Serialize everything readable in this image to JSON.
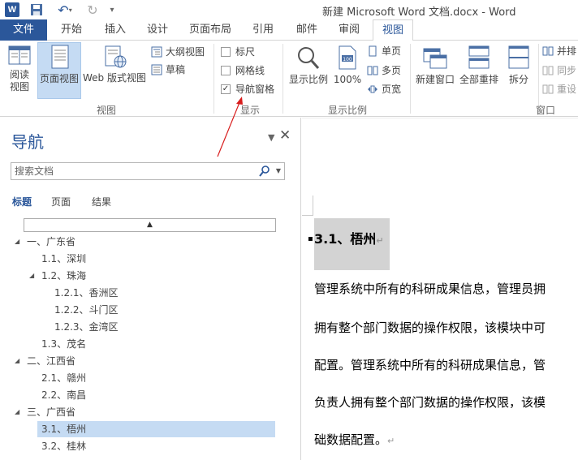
{
  "title_bar": {
    "word_logo": "W",
    "title": "新建 Microsoft Word 文档.docx - Word"
  },
  "tabs": [
    "文件",
    "开始",
    "插入",
    "设计",
    "页面布局",
    "引用",
    "邮件",
    "审阅",
    "视图"
  ],
  "active_tab": "视图",
  "ribbon": {
    "views": {
      "read_mode": "阅读\n视图",
      "print_layout": "页面视图",
      "web_layout": "Web 版式视图",
      "outline": "大纲视图",
      "draft": "草稿",
      "group_label": "视图"
    },
    "show": {
      "ruler": "标尺",
      "gridlines": "网格线",
      "nav_pane": "导航窗格",
      "ruler_checked": false,
      "gridlines_checked": false,
      "nav_pane_checked": true,
      "group_label": "显示"
    },
    "zoom": {
      "zoom": "显示比例",
      "hundred": "100%",
      "one_page": "单页",
      "multi_page": "多页",
      "page_width": "页宽",
      "group_label": "显示比例"
    },
    "window": {
      "new_window": "新建窗口",
      "arrange_all": "全部重排",
      "split": "拆分",
      "side_by_side": "并排",
      "sync": "同步",
      "reset": "重设",
      "group_label": "窗口"
    }
  },
  "nav": {
    "title": "导航",
    "search_placeholder": "搜索文档",
    "tabs": [
      "标题",
      "页面",
      "结果"
    ],
    "items": [
      {
        "text": "一、广东省",
        "collapsible": true
      },
      {
        "text": "1.1、深圳",
        "collapsible": false
      },
      {
        "text": "1.2、珠海",
        "collapsible": true
      },
      {
        "text": "1.2.1、香洲区",
        "collapsible": false
      },
      {
        "text": "1.2.2、斗门区",
        "collapsible": false
      },
      {
        "text": "1.2.3、金湾区",
        "collapsible": false
      },
      {
        "text": "1.3、茂名",
        "collapsible": false
      },
      {
        "text": "二、江西省",
        "collapsible": true
      },
      {
        "text": "2.1、赣州",
        "collapsible": false
      },
      {
        "text": "2.2、南昌",
        "collapsible": false
      },
      {
        "text": "三、广西省",
        "collapsible": true
      },
      {
        "text": "3.1、梧州",
        "collapsible": false,
        "selected": true
      },
      {
        "text": "3.2、桂林",
        "collapsible": false
      }
    ]
  },
  "document": {
    "heading": "3.1、梧州",
    "lines": [
      "管理系统中所有的科研成果信息，管理员拥",
      "拥有整个部门数据的操作权限，该模块中可",
      "配置。管理系统中所有的科研成果信息，管",
      "负责人拥有整个部门数据的操作权限，该模",
      "础数据配置。"
    ]
  },
  "colors": {
    "accent": "#2b579a",
    "selection": "#c5dbf3",
    "arrow": "#d81e1e"
  }
}
